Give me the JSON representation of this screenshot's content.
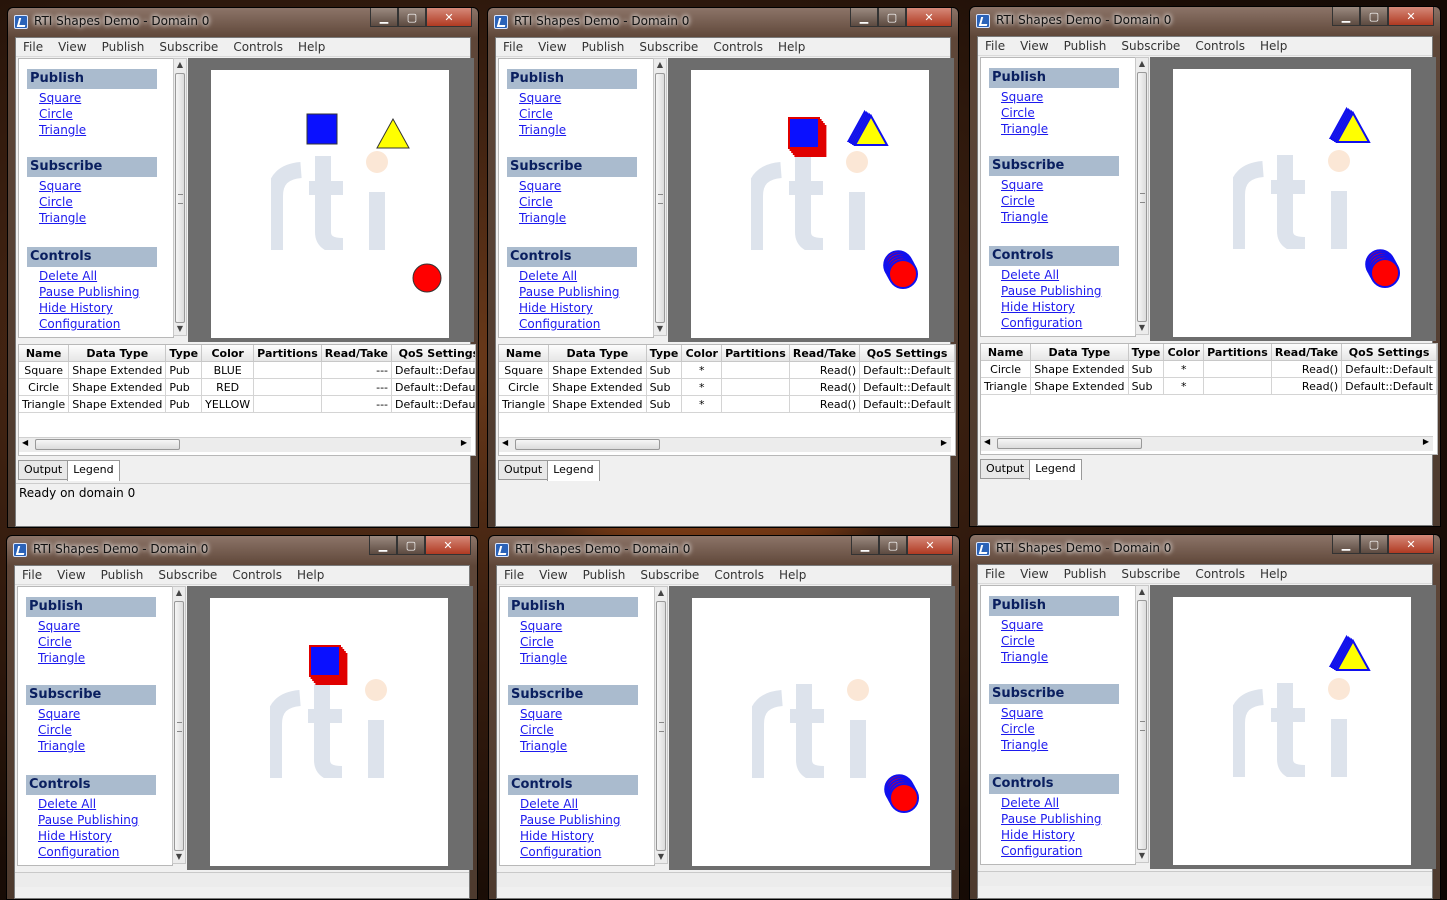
{
  "windows": [
    {
      "id": "w1",
      "title": "RTI Shapes Demo - Domain 0",
      "menu": [
        "File",
        "View",
        "Publish",
        "Subscribe",
        "Controls",
        "Help"
      ],
      "sections": {
        "publish": {
          "title": "Publish",
          "items": [
            "Square",
            "Circle",
            "Triangle"
          ]
        },
        "subscribe": {
          "title": "Subscribe",
          "items": [
            "Square",
            "Circle",
            "Triangle"
          ]
        },
        "controls": {
          "title": "Controls",
          "items": [
            "Delete All",
            "Pause Publishing",
            "Hide History",
            "Configuration"
          ]
        }
      },
      "columns": [
        "Name",
        "Data Type",
        "Type",
        "Color",
        "Partitions",
        "Read/Take",
        "QoS Settings"
      ],
      "rows": [
        [
          "Square",
          "Shape Extended",
          "Pub",
          "BLUE",
          "",
          "---",
          "Default::Default"
        ],
        [
          "Circle",
          "Shape Extended",
          "Pub",
          "RED",
          "",
          "---",
          "Default::Default"
        ],
        [
          "Triangle",
          "Shape Extended",
          "Pub",
          "YELLOW",
          "",
          "---",
          "Default::Default"
        ]
      ],
      "tabs": [
        "Output",
        "Legend"
      ],
      "status": "Ready on domain 0"
    },
    {
      "id": "w2",
      "title": "RTI Shapes Demo - Domain 0",
      "menu": [
        "File",
        "View",
        "Publish",
        "Subscribe",
        "Controls",
        "Help"
      ],
      "sections": {
        "publish": {
          "title": "Publish",
          "items": [
            "Square",
            "Circle",
            "Triangle"
          ]
        },
        "subscribe": {
          "title": "Subscribe",
          "items": [
            "Square",
            "Circle",
            "Triangle"
          ]
        },
        "controls": {
          "title": "Controls",
          "items": [
            "Delete All",
            "Pause Publishing",
            "Hide History",
            "Configuration"
          ]
        }
      },
      "columns": [
        "Name",
        "Data Type",
        "Type",
        "Color",
        "Partitions",
        "Read/Take",
        "QoS Settings"
      ],
      "rows": [
        [
          "Square",
          "Shape Extended",
          "Sub",
          "*",
          "",
          "Read()",
          "Default::Default"
        ],
        [
          "Circle",
          "Shape Extended",
          "Sub",
          "*",
          "",
          "Read()",
          "Default::Default"
        ],
        [
          "Triangle",
          "Shape Extended",
          "Sub",
          "*",
          "",
          "Read()",
          "Default::Default"
        ]
      ],
      "tabs": [
        "Output",
        "Legend"
      ]
    },
    {
      "id": "w3",
      "title": "RTI Shapes Demo - Domain 0",
      "menu": [
        "File",
        "View",
        "Publish",
        "Subscribe",
        "Controls",
        "Help"
      ],
      "sections": {
        "publish": {
          "title": "Publish",
          "items": [
            "Square",
            "Circle",
            "Triangle"
          ]
        },
        "subscribe": {
          "title": "Subscribe",
          "items": [
            "Square",
            "Circle",
            "Triangle"
          ]
        },
        "controls": {
          "title": "Controls",
          "items": [
            "Delete All",
            "Pause Publishing",
            "Hide History",
            "Configuration"
          ]
        }
      },
      "columns": [
        "Name",
        "Data Type",
        "Type",
        "Color",
        "Partitions",
        "Read/Take",
        "QoS Settings"
      ],
      "rows": [
        [
          "Circle",
          "Shape Extended",
          "Sub",
          "*",
          "",
          "Read()",
          "Default::Default"
        ],
        [
          "Triangle",
          "Shape Extended",
          "Sub",
          "*",
          "",
          "Read()",
          "Default::Default"
        ]
      ],
      "tabs": [
        "Output",
        "Legend"
      ]
    },
    {
      "id": "w4",
      "title": "RTI Shapes Demo - Domain 0",
      "menu": [
        "File",
        "View",
        "Publish",
        "Subscribe",
        "Controls",
        "Help"
      ],
      "sections": {
        "publish": {
          "title": "Publish",
          "items": [
            "Square",
            "Circle",
            "Triangle"
          ]
        },
        "subscribe": {
          "title": "Subscribe",
          "items": [
            "Square",
            "Circle",
            "Triangle"
          ]
        },
        "controls": {
          "title": "Controls",
          "items": [
            "Delete All",
            "Pause Publishing",
            "Hide History",
            "Configuration"
          ]
        }
      }
    },
    {
      "id": "w5",
      "title": "RTI Shapes Demo - Domain 0",
      "menu": [
        "File",
        "View",
        "Publish",
        "Subscribe",
        "Controls",
        "Help"
      ],
      "sections": {
        "publish": {
          "title": "Publish",
          "items": [
            "Square",
            "Circle",
            "Triangle"
          ]
        },
        "subscribe": {
          "title": "Subscribe",
          "items": [
            "Square",
            "Circle",
            "Triangle"
          ]
        },
        "controls": {
          "title": "Controls",
          "items": [
            "Delete All",
            "Pause Publishing",
            "Hide History",
            "Configuration"
          ]
        }
      }
    },
    {
      "id": "w6",
      "title": "RTI Shapes Demo - Domain 0",
      "menu": [
        "File",
        "View",
        "Publish",
        "Subscribe",
        "Controls",
        "Help"
      ],
      "sections": {
        "publish": {
          "title": "Publish",
          "items": [
            "Square",
            "Circle",
            "Triangle"
          ]
        },
        "subscribe": {
          "title": "Subscribe",
          "items": [
            "Square",
            "Circle",
            "Triangle"
          ]
        },
        "controls": {
          "title": "Controls",
          "items": [
            "Delete All",
            "Pause Publishing",
            "Hide History",
            "Configuration"
          ]
        }
      }
    }
  ],
  "colors": {
    "section_bg": "#aabbce",
    "section_text": "#0a1f5f",
    "link": "#1d1aee",
    "shape_blue": "#0a10ff",
    "shape_red": "#ff0000",
    "shape_yellow": "#ffff00",
    "sub_outline_red": "#e00000",
    "sub_outline_blue": "#1010ee"
  },
  "shapes": {
    "w1": [
      {
        "kind": "square",
        "fill": "blue",
        "stroke": "dark",
        "trail": 0
      },
      {
        "kind": "triangle",
        "fill": "yellow",
        "stroke": "dark",
        "trail": 0
      },
      {
        "kind": "circle",
        "fill": "red",
        "stroke": "dark",
        "trail": 0
      }
    ],
    "w2": [
      {
        "kind": "square",
        "fill": "blue",
        "stroke": "red",
        "trail": 4
      },
      {
        "kind": "triangle",
        "fill": "yellow",
        "stroke": "blue",
        "trail": 4
      },
      {
        "kind": "circle",
        "fill": "red",
        "stroke": "blue",
        "trail": 4
      }
    ],
    "w3": [
      {
        "kind": "triangle",
        "fill": "yellow",
        "stroke": "blue",
        "trail": 4
      },
      {
        "kind": "circle",
        "fill": "red",
        "stroke": "blue",
        "trail": 4
      }
    ],
    "w4": [
      {
        "kind": "square",
        "fill": "blue",
        "stroke": "red",
        "trail": 4
      }
    ],
    "w5": [
      {
        "kind": "circle",
        "fill": "red",
        "stroke": "blue",
        "trail": 4
      }
    ],
    "w6": [
      {
        "kind": "triangle",
        "fill": "yellow",
        "stroke": "blue",
        "trail": 4
      }
    ]
  }
}
